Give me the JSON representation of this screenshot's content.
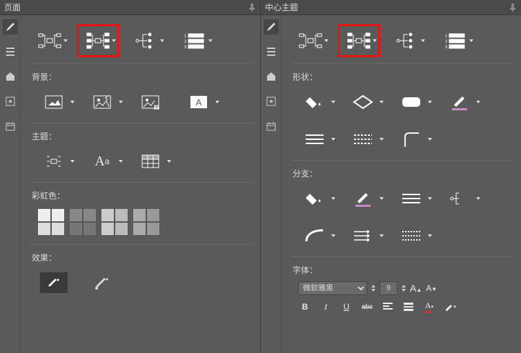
{
  "left": {
    "title": "页面",
    "sections": {
      "background": "背景：",
      "theme": "主题：",
      "rainbow": "彩虹色：",
      "effect": "效果："
    }
  },
  "right": {
    "title": "中心主题",
    "sections": {
      "shape": "形状：",
      "branch": "分支：",
      "font": "字体："
    },
    "font": {
      "family": "微软雅黑",
      "size": "9"
    },
    "fmt": {
      "b": "B",
      "i": "I",
      "u": "U",
      "s": "abc"
    }
  }
}
